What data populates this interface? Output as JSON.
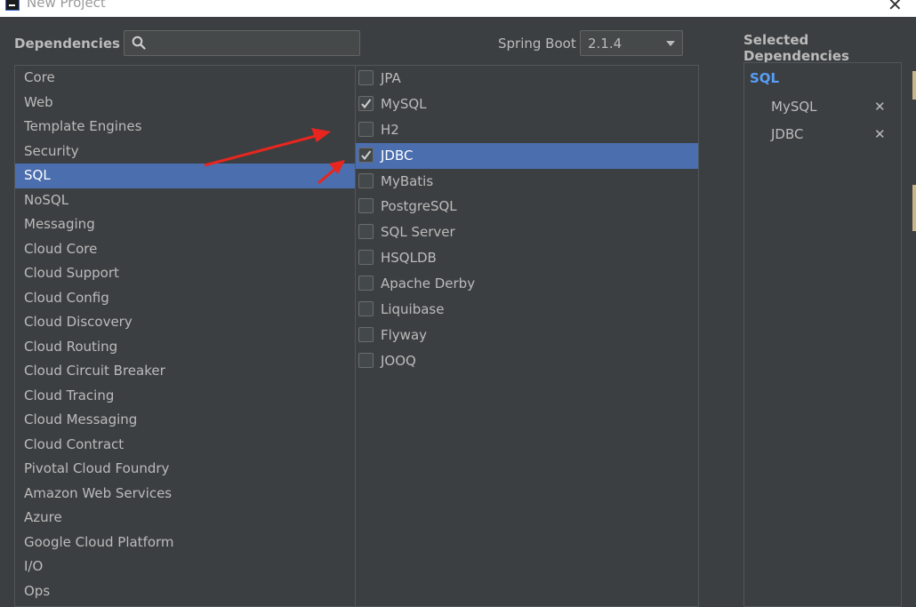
{
  "window": {
    "title": "New Project",
    "close_glyph": "✕",
    "icon": "intellij-app-icon"
  },
  "header": {
    "dependencies_label": "Dependencies",
    "search": {
      "value": "",
      "placeholder": "",
      "icon": "search-icon"
    },
    "spring_boot_label": "Spring Boot",
    "spring_boot_version": "2.1.4",
    "selected_label": "Selected Dependencies"
  },
  "categories": [
    {
      "label": "Core",
      "selected": false
    },
    {
      "label": "Web",
      "selected": false
    },
    {
      "label": "Template Engines",
      "selected": false
    },
    {
      "label": "Security",
      "selected": false
    },
    {
      "label": "SQL",
      "selected": true
    },
    {
      "label": "NoSQL",
      "selected": false
    },
    {
      "label": "Messaging",
      "selected": false
    },
    {
      "label": "Cloud Core",
      "selected": false
    },
    {
      "label": "Cloud Support",
      "selected": false
    },
    {
      "label": "Cloud Config",
      "selected": false
    },
    {
      "label": "Cloud Discovery",
      "selected": false
    },
    {
      "label": "Cloud Routing",
      "selected": false
    },
    {
      "label": "Cloud Circuit Breaker",
      "selected": false
    },
    {
      "label": "Cloud Tracing",
      "selected": false
    },
    {
      "label": "Cloud Messaging",
      "selected": false
    },
    {
      "label": "Cloud Contract",
      "selected": false
    },
    {
      "label": "Pivotal Cloud Foundry",
      "selected": false
    },
    {
      "label": "Amazon Web Services",
      "selected": false
    },
    {
      "label": "Azure",
      "selected": false
    },
    {
      "label": "Google Cloud Platform",
      "selected": false
    },
    {
      "label": "I/O",
      "selected": false
    },
    {
      "label": "Ops",
      "selected": false
    }
  ],
  "dependencies": [
    {
      "label": "JPA",
      "checked": false,
      "selected": false
    },
    {
      "label": "MySQL",
      "checked": true,
      "selected": false
    },
    {
      "label": "H2",
      "checked": false,
      "selected": false
    },
    {
      "label": "JDBC",
      "checked": true,
      "selected": true
    },
    {
      "label": "MyBatis",
      "checked": false,
      "selected": false
    },
    {
      "label": "PostgreSQL",
      "checked": false,
      "selected": false
    },
    {
      "label": "SQL Server",
      "checked": false,
      "selected": false
    },
    {
      "label": "HSQLDB",
      "checked": false,
      "selected": false
    },
    {
      "label": "Apache Derby",
      "checked": false,
      "selected": false
    },
    {
      "label": "Liquibase",
      "checked": false,
      "selected": false
    },
    {
      "label": "Flyway",
      "checked": false,
      "selected": false
    },
    {
      "label": "JOOQ",
      "checked": false,
      "selected": false
    }
  ],
  "selected_dependencies": {
    "group": "SQL",
    "items": [
      "MySQL",
      "JDBC"
    ],
    "remove_glyph": "✕"
  },
  "colors": {
    "background": "#3c3f41",
    "selection": "#4b6eaf",
    "group_accent": "#589df6",
    "annotation_arrow": "#e8261f"
  }
}
